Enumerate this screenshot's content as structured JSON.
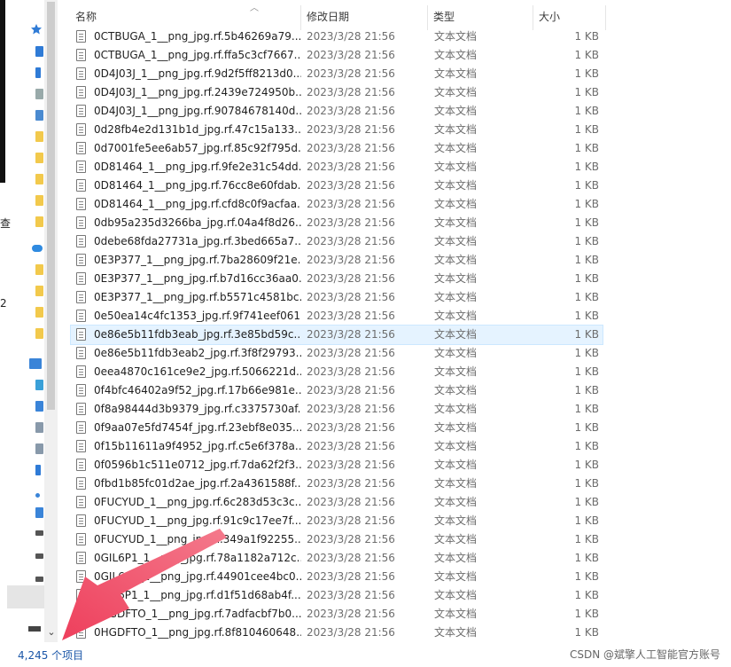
{
  "columns": {
    "name": "名称",
    "date": "修改日期",
    "type": "类型",
    "size": "大小"
  },
  "files": [
    {
      "name": "0CTBUGA_1__png_jpg.rf.5b46269a79...",
      "date": "2023/3/28 21:56",
      "type": "文本文档",
      "size": "1 KB"
    },
    {
      "name": "0CTBUGA_1__png_jpg.rf.ffa5c3cf7667...",
      "date": "2023/3/28 21:56",
      "type": "文本文档",
      "size": "1 KB"
    },
    {
      "name": "0D4J03J_1__png_jpg.rf.9d2f5ff8213d0...",
      "date": "2023/3/28 21:56",
      "type": "文本文档",
      "size": "1 KB"
    },
    {
      "name": "0D4J03J_1__png_jpg.rf.2439e724950b...",
      "date": "2023/3/28 21:56",
      "type": "文本文档",
      "size": "1 KB"
    },
    {
      "name": "0D4J03J_1__png_jpg.rf.90784678140d...",
      "date": "2023/3/28 21:56",
      "type": "文本文档",
      "size": "1 KB"
    },
    {
      "name": "0d28fb4e2d131b1d_jpg.rf.47c15a133...",
      "date": "2023/3/28 21:56",
      "type": "文本文档",
      "size": "1 KB"
    },
    {
      "name": "0d7001fe5ee6ab57_jpg.rf.85c92f795d...",
      "date": "2023/3/28 21:56",
      "type": "文本文档",
      "size": "1 KB"
    },
    {
      "name": "0D81464_1__png_jpg.rf.9fe2e31c54dd...",
      "date": "2023/3/28 21:56",
      "type": "文本文档",
      "size": "1 KB"
    },
    {
      "name": "0D81464_1__png_jpg.rf.76cc8e60fdab...",
      "date": "2023/3/28 21:56",
      "type": "文本文档",
      "size": "1 KB"
    },
    {
      "name": "0D81464_1__png_jpg.rf.cfd8c0f9acfaa...",
      "date": "2023/3/28 21:56",
      "type": "文本文档",
      "size": "1 KB"
    },
    {
      "name": "0db95a235d3266ba_jpg.rf.04a4f8d26...",
      "date": "2023/3/28 21:56",
      "type": "文本文档",
      "size": "1 KB"
    },
    {
      "name": "0debe68fda27731a_jpg.rf.3bed665a7...",
      "date": "2023/3/28 21:56",
      "type": "文本文档",
      "size": "1 KB"
    },
    {
      "name": "0E3P377_1__png_jpg.rf.7ba28609f21e...",
      "date": "2023/3/28 21:56",
      "type": "文本文档",
      "size": "1 KB"
    },
    {
      "name": "0E3P377_1__png_jpg.rf.b7d16cc36aa0...",
      "date": "2023/3/28 21:56",
      "type": "文本文档",
      "size": "1 KB"
    },
    {
      "name": "0E3P377_1__png_jpg.rf.b5571c4581bc...",
      "date": "2023/3/28 21:56",
      "type": "文本文档",
      "size": "1 KB"
    },
    {
      "name": "0e50ea14c4fc1353_jpg.rf.9f741eef061...",
      "date": "2023/3/28 21:56",
      "type": "文本文档",
      "size": "1 KB"
    },
    {
      "name": "0e86e5b11fdb3eab_jpg.rf.3e85bd59c...",
      "date": "2023/3/28 21:56",
      "type": "文本文档",
      "size": "1 KB",
      "selected": true
    },
    {
      "name": "0e86e5b11fdb3eab2_jpg.rf.3f8f29793...",
      "date": "2023/3/28 21:56",
      "type": "文本文档",
      "size": "1 KB"
    },
    {
      "name": "0eea4870c161ce9e2_jpg.rf.5066221d...",
      "date": "2023/3/28 21:56",
      "type": "文本文档",
      "size": "1 KB"
    },
    {
      "name": "0f4bfc46402a9f52_jpg.rf.17b66e981e...",
      "date": "2023/3/28 21:56",
      "type": "文本文档",
      "size": "1 KB"
    },
    {
      "name": "0f8a98444d3b9379_jpg.rf.c3375730af...",
      "date": "2023/3/28 21:56",
      "type": "文本文档",
      "size": "1 KB"
    },
    {
      "name": "0f9aa07e5fd7454f_jpg.rf.23ebf8e035...",
      "date": "2023/3/28 21:56",
      "type": "文本文档",
      "size": "1 KB"
    },
    {
      "name": "0f15b11611a9f4952_jpg.rf.c5e6f378a...",
      "date": "2023/3/28 21:56",
      "type": "文本文档",
      "size": "1 KB"
    },
    {
      "name": "0f0596b1c511e0712_jpg.rf.7da62f2f3...",
      "date": "2023/3/28 21:56",
      "type": "文本文档",
      "size": "1 KB"
    },
    {
      "name": "0fbd1b85fc01d2ae_jpg.rf.2a4361588f...",
      "date": "2023/3/28 21:56",
      "type": "文本文档",
      "size": "1 KB"
    },
    {
      "name": "0FUCYUD_1__png_jpg.rf.6c283d53c3c...",
      "date": "2023/3/28 21:56",
      "type": "文本文档",
      "size": "1 KB"
    },
    {
      "name": "0FUCYUD_1__png_jpg.rf.91c9c17ee7f...",
      "date": "2023/3/28 21:56",
      "type": "文本文档",
      "size": "1 KB"
    },
    {
      "name": "0FUCYUD_1__png_jpg.rf.349a1f92255...",
      "date": "2023/3/28 21:56",
      "type": "文本文档",
      "size": "1 KB"
    },
    {
      "name": "0GIL6P1_1__png_jpg.rf.78a1182a712c...",
      "date": "2023/3/28 21:56",
      "type": "文本文档",
      "size": "1 KB"
    },
    {
      "name": "0GIL6P1_1__png_jpg.rf.44901cee4bc0...",
      "date": "2023/3/28 21:56",
      "type": "文本文档",
      "size": "1 KB"
    },
    {
      "name": "0GIL6P1_1__png_jpg.rf.d1f51d68ab4f...",
      "date": "2023/3/28 21:56",
      "type": "文本文档",
      "size": "1 KB"
    },
    {
      "name": "0HGDFTO_1__png_jpg.rf.7adfacbf7b0...",
      "date": "2023/3/28 21:56",
      "type": "文本文档",
      "size": "1 KB"
    },
    {
      "name": "0HGDFTO_1__png_jpg.rf.8f810460648...",
      "date": "2023/3/28 21:56",
      "type": "文本文档",
      "size": "1 KB"
    }
  ],
  "status": {
    "item_count": "4,245 个项目"
  },
  "watermark": "CSDN @斌擎人工智能官方账号",
  "left_edge_labels": [
    "查",
    "2"
  ],
  "colors": {
    "selection_bg": "#e5f3ff",
    "arrow": "#f0506e",
    "status_text": "#1a56a8"
  },
  "icons": {
    "file": "text-document-icon",
    "sort": "sort-ascending-icon",
    "annotation": "red-arrow-annotation"
  }
}
